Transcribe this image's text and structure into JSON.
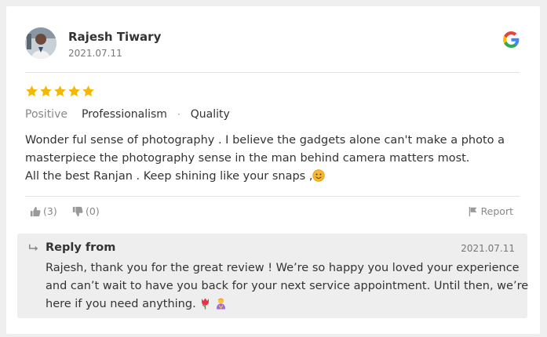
{
  "reviewer": {
    "name": "Rajesh Tiwary",
    "date": "2021.07.11"
  },
  "source_icon": "google-icon",
  "rating": {
    "value": 5,
    "max": 5,
    "star_color": "#f5b800"
  },
  "tags": {
    "sentiment": "Positive",
    "items": [
      "Professionalism",
      "Quality"
    ]
  },
  "review": {
    "lines": [
      "Wonder ful sense of photography . I believe the gadgets alone can't make a photo a",
      "masterpiece the photography sense in the man behind camera matters most.",
      "All the best Ranjan . Keep shining like your snaps ,"
    ],
    "emoji": "smiling-face-icon"
  },
  "actions": {
    "likes": "(3)",
    "dislikes": "(0)",
    "report": "Report"
  },
  "reply": {
    "title": "Reply from",
    "date": "2021.07.11",
    "lines": [
      "Rajesh, thank you for the great review ! We’re so happy you loved your experience",
      "and can’t wait to have you back for your next service appointment. Until then, we’re",
      "here if you need anything."
    ],
    "emojis": [
      "tulip-icon",
      "person-bowing-icon"
    ]
  },
  "colors": {
    "background": "#efefef",
    "card": "#ffffff",
    "reply_background": "#eeeeee",
    "muted_text": "#888888"
  }
}
